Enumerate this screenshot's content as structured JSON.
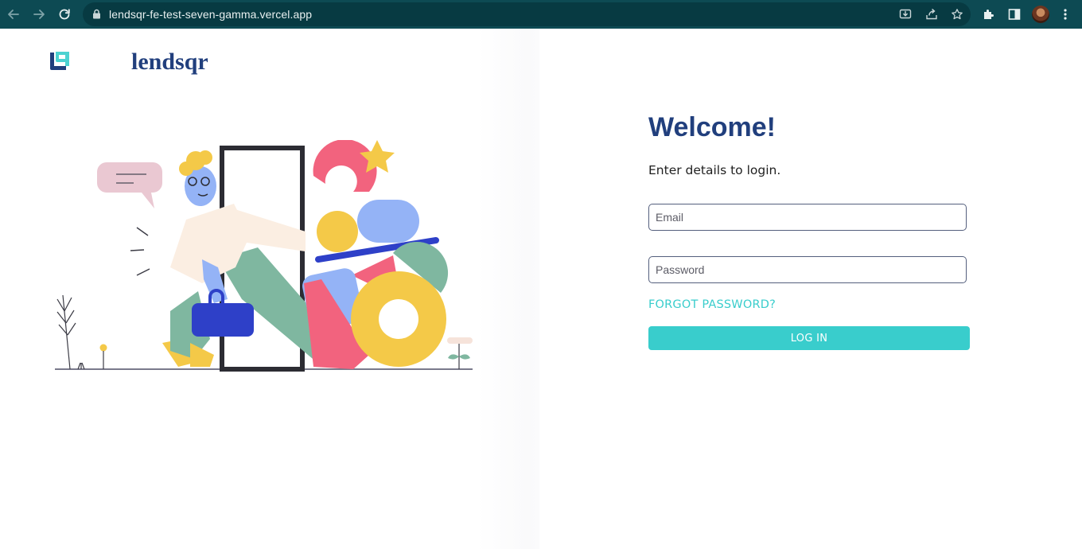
{
  "browser": {
    "url": "lendsqr-fe-test-seven-gamma.vercel.app",
    "icons": [
      "back-arrow-icon",
      "forward-arrow-icon",
      "reload-icon",
      "lock-icon",
      "install-app-icon",
      "share-icon",
      "bookmark-star-icon",
      "extensions-puzzle-icon",
      "side-panel-icon",
      "profile-avatar",
      "more-menu-icon"
    ]
  },
  "brand": {
    "name": "lendsqr",
    "color": "#213f7d",
    "accent": "#39cdcc"
  },
  "login": {
    "title": "Welcome!",
    "subtitle": "Enter details to login.",
    "email_placeholder": "Email",
    "password_placeholder": "Password",
    "forgot_label": "FORGOT PASSWORD?",
    "login_label": "LOG IN"
  }
}
